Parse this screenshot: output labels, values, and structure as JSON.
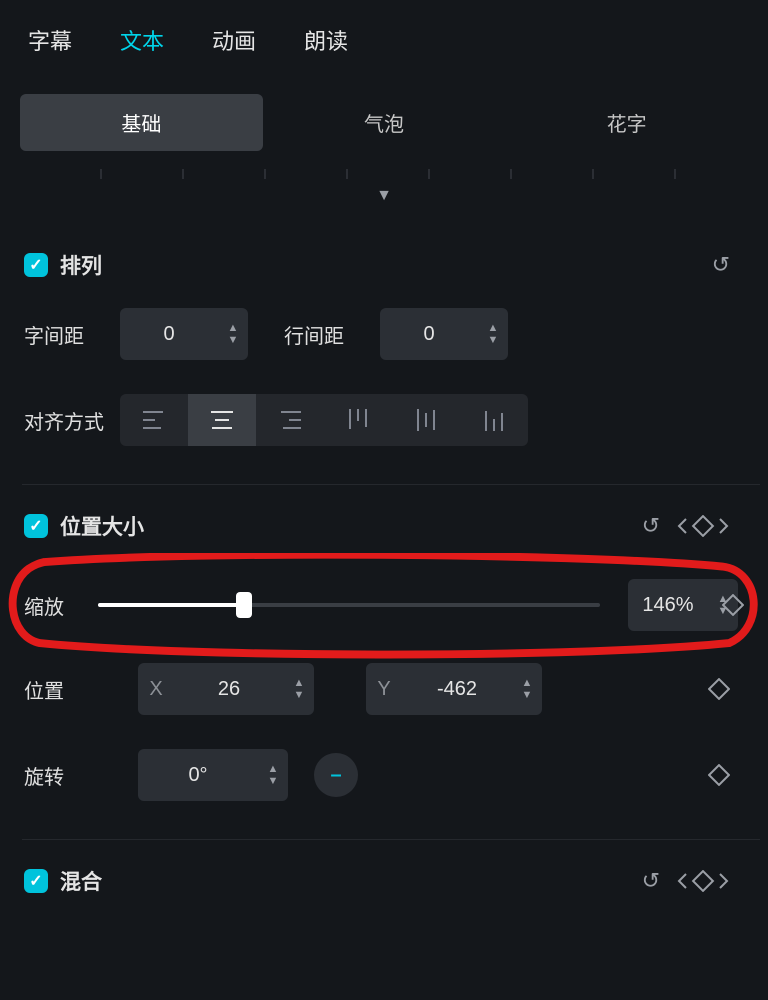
{
  "tabs": {
    "top": [
      "字幕",
      "文本",
      "动画",
      "朗读"
    ],
    "activeTop": 1,
    "sub": [
      "基础",
      "气泡",
      "花字"
    ],
    "activeSub": 0
  },
  "sections": {
    "arrange": {
      "title": "排列",
      "charSpacingLabel": "字间距",
      "charSpacing": "0",
      "lineSpacingLabel": "行间距",
      "lineSpacing": "0",
      "alignLabel": "对齐方式"
    },
    "posSize": {
      "title": "位置大小",
      "scaleLabel": "缩放",
      "scalePercent": 146,
      "scaleDisplay": "146%",
      "positionLabel": "位置",
      "xLabel": "X",
      "x": "26",
      "yLabel": "Y",
      "y": "-462",
      "rotationLabel": "旋转",
      "rotation": "0°"
    },
    "blend": {
      "title": "混合"
    }
  }
}
